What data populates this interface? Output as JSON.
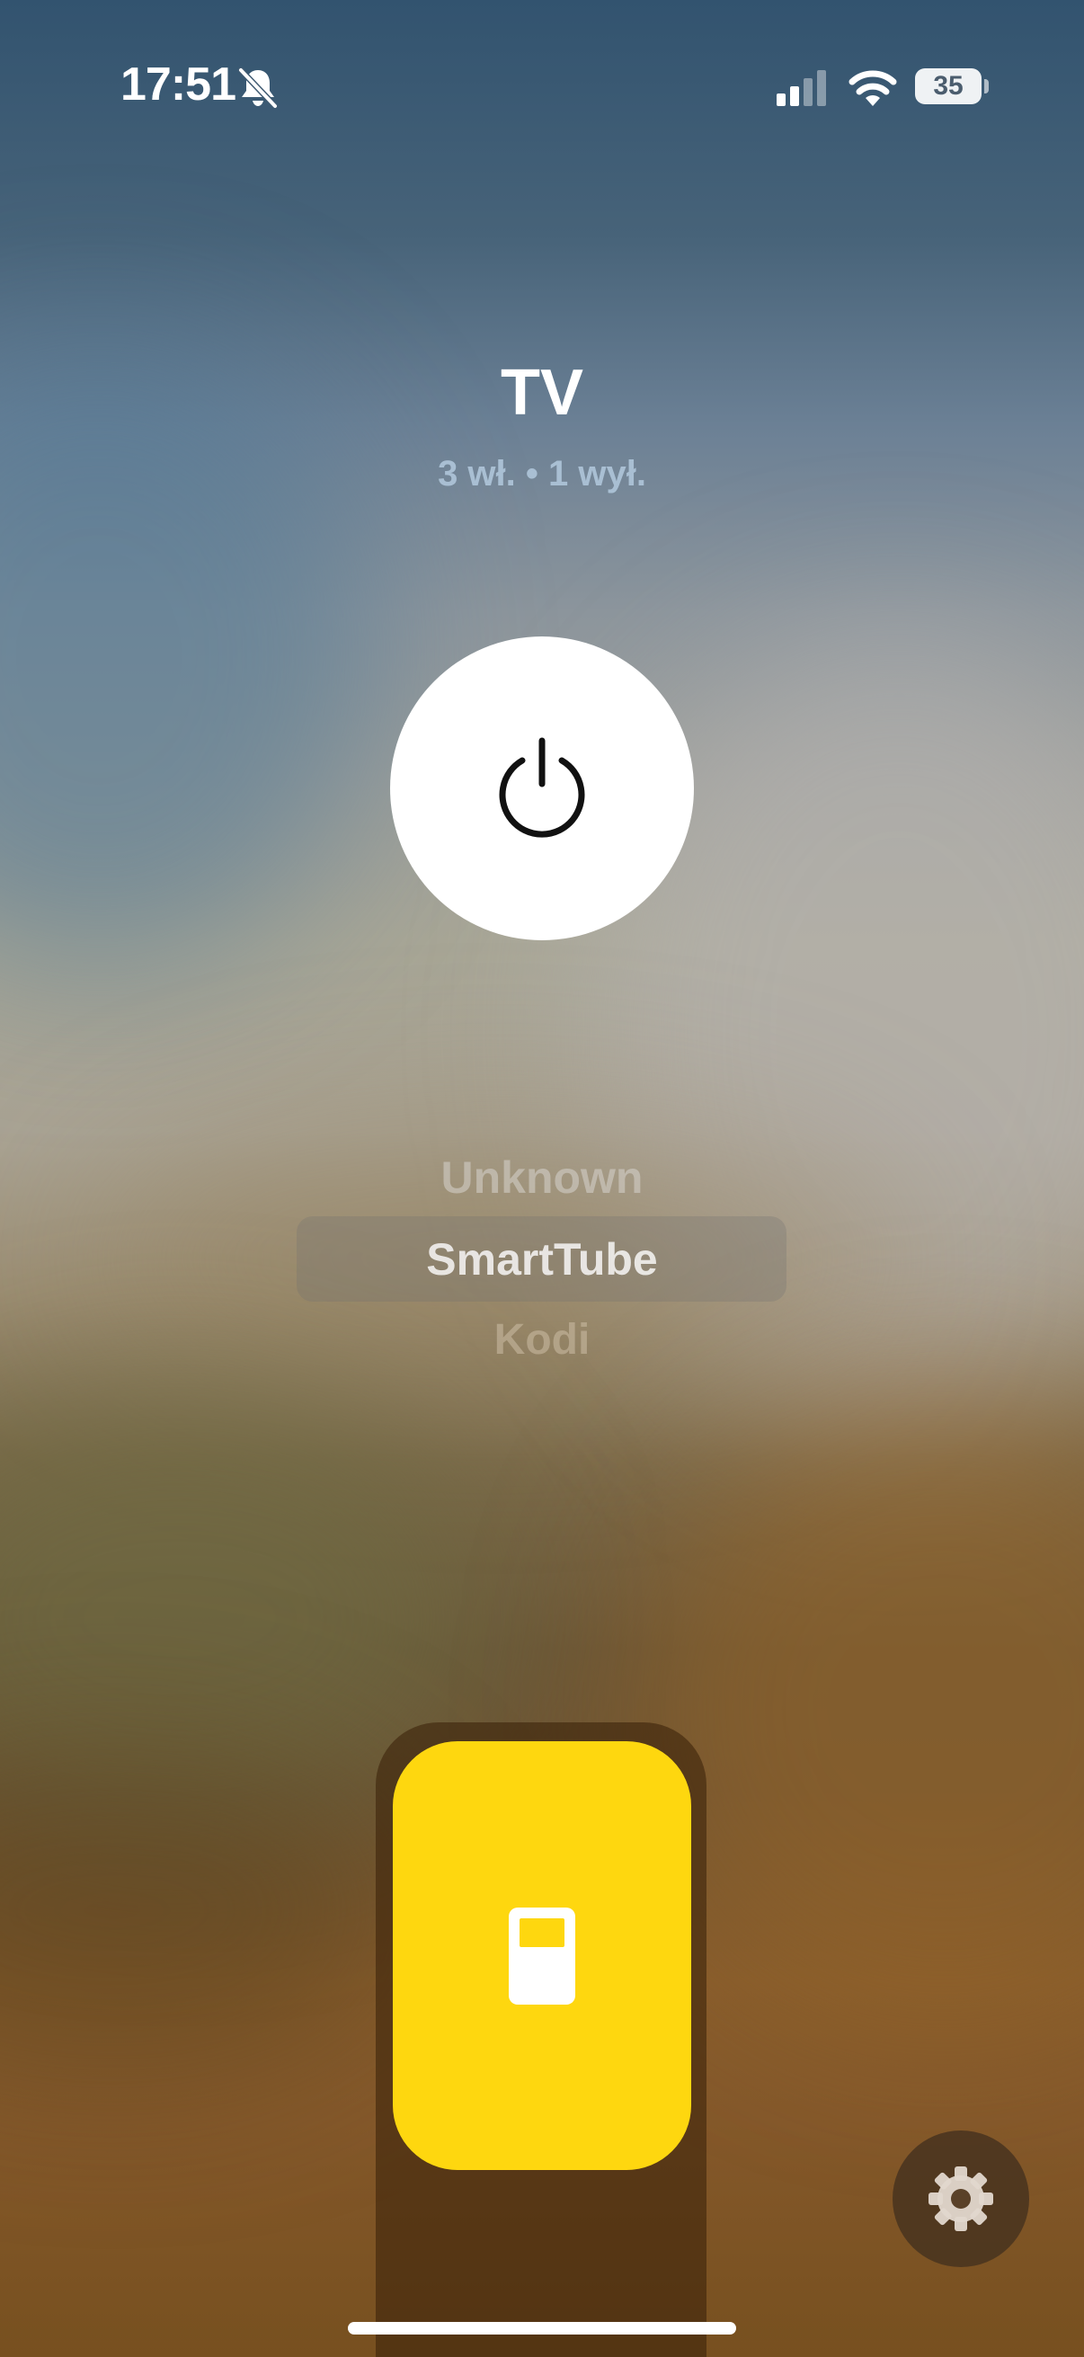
{
  "status_bar": {
    "time": "17:51",
    "battery": "35",
    "icons": [
      "bell-slash-icon",
      "signal-icon",
      "wifi-icon",
      "battery-icon"
    ]
  },
  "header": {
    "title": "TV",
    "subtitle": "3 wł. • 1 wył."
  },
  "power": {
    "icon": "power-icon"
  },
  "picker": {
    "items": [
      "Unknown",
      "SmartTube",
      "Kodi"
    ],
    "selected": "SmartTube"
  },
  "device_card": {
    "icon": "remote-icon",
    "color": "#FED70F"
  },
  "settings": {
    "icon": "gear-icon"
  }
}
